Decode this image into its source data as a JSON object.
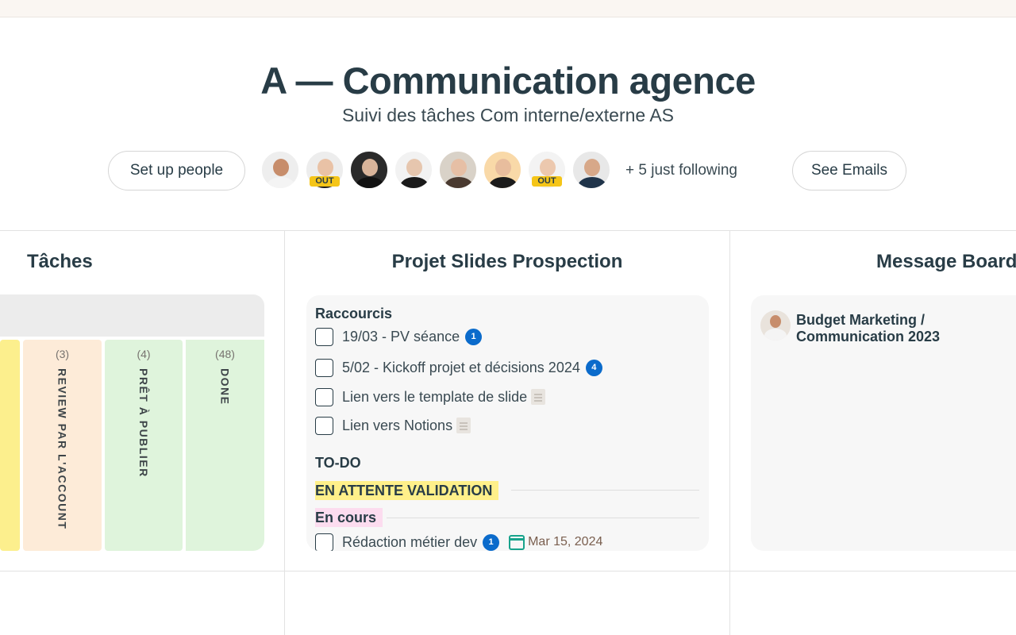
{
  "project": {
    "title": "A — Communication agence",
    "description": "Suivi des tâches Com interne/externe AS"
  },
  "people": {
    "setup_label": "Set up people",
    "following_label": "+ 5 just following",
    "emails_label": "See Emails",
    "out_label": "OUT",
    "avatars": [
      {
        "name": "avatar-1",
        "out": false,
        "skin": "#c78d6b",
        "shirt": "#f4f4f4",
        "bg": "#eeeeee"
      },
      {
        "name": "avatar-2",
        "out": true,
        "skin": "#e9c2a6",
        "shirt": "#1d1d1d",
        "bg": "#ededed"
      },
      {
        "name": "avatar-3",
        "out": false,
        "skin": "#d9b49a",
        "shirt": "#111111",
        "bg": "#2a2a2a"
      },
      {
        "name": "avatar-4",
        "out": false,
        "skin": "#e6c6ae",
        "shirt": "#1a1a1a",
        "bg": "#f2f2f2"
      },
      {
        "name": "avatar-5",
        "out": false,
        "skin": "#e6bfa5",
        "shirt": "#4a3a30",
        "bg": "#d9d2c8"
      },
      {
        "name": "avatar-6",
        "out": false,
        "skin": "#e8bd9d",
        "shirt": "#1b1b1b",
        "bg": "#f9d9a8"
      },
      {
        "name": "avatar-7",
        "out": true,
        "skin": "#ecc8ae",
        "shirt": "#f1f1f1",
        "bg": "#f3f3f3"
      },
      {
        "name": "avatar-8",
        "out": false,
        "skin": "#d7a889",
        "shirt": "#20344a",
        "bg": "#e8e8e8"
      }
    ]
  },
  "cards": {
    "taches": {
      "title": "Tâches",
      "columns": [
        {
          "count": "",
          "label": "",
          "color": "#fcef8d"
        },
        {
          "count": "(3)",
          "label": "REVIEW PAR L'ACCOUNT",
          "color": "#fdebd8"
        },
        {
          "count": "(4)",
          "label": "PRÊT À PUBLIER",
          "color": "#dff4dc"
        },
        {
          "count": "(48)",
          "label": "DONE",
          "color": "#dff4dc"
        }
      ]
    },
    "slides": {
      "title": "Projet Slides Prospection",
      "shortcuts_heading": "Raccourcis",
      "shortcuts": [
        {
          "label": "19/03 - PV séance",
          "badge": "1"
        },
        {
          "label": "5/02 - Kickoff projet et décisions 2024",
          "badge": "4"
        },
        {
          "label": "Lien vers le template de slide",
          "doc_icon": "document-icon"
        },
        {
          "label": "Lien vers Notions",
          "doc_icon": "document-icon"
        }
      ],
      "todo_heading": "TO-DO",
      "groups": [
        {
          "label": "EN ATTENTE VALIDATION",
          "color": "#fff08a"
        },
        {
          "label": "En cours",
          "color": "#fcdcef"
        }
      ],
      "task": {
        "label": "Rédaction métier dev",
        "badge": "1",
        "due": "Mar 15, 2024"
      }
    },
    "message_board": {
      "title": "Message Board",
      "post_title": "Budget Marketing / Communication 2023"
    }
  }
}
